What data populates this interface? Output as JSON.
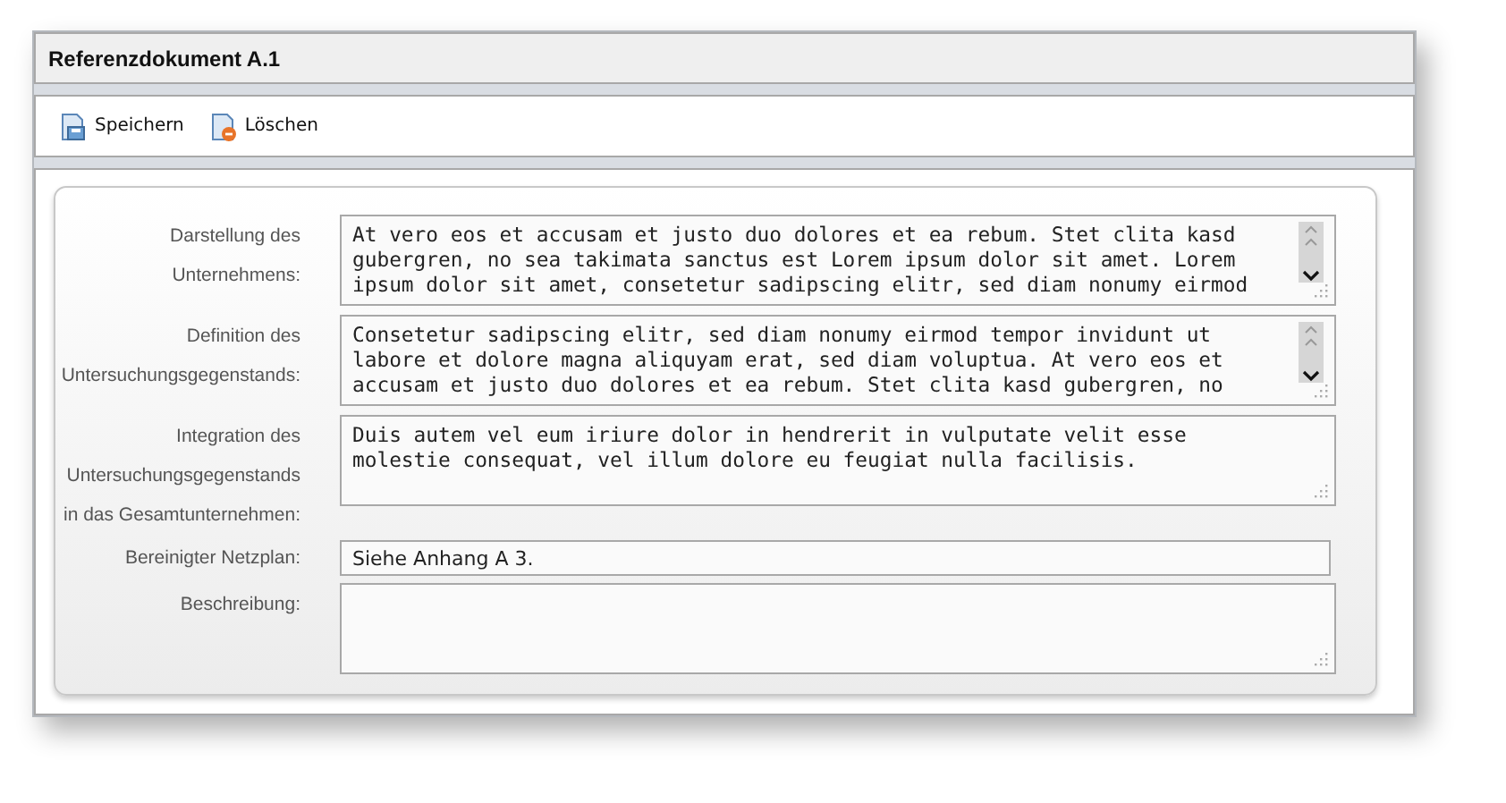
{
  "window": {
    "title": "Referenzdokument A.1"
  },
  "toolbar": [
    {
      "kind": "save",
      "label": "Speichern"
    },
    {
      "kind": "delete",
      "label": "Löschen"
    }
  ],
  "fields": [
    {
      "kind": "textarea",
      "label_lines": [
        "Darstellung des",
        "Unternehmens:"
      ],
      "value": "At vero eos et accusam et justo duo dolores et ea rebum. Stet clita kasd\ngubergren, no sea takimata sanctus est Lorem ipsum dolor sit amet. Lorem\nipsum dolor sit amet, consetetur sadipscing elitr, sed diam nonumy eirmod",
      "scrollbar": true
    },
    {
      "kind": "textarea",
      "label_lines": [
        "Definition des",
        "Untersuchungsgegenstands:"
      ],
      "value": "Consetetur sadipscing elitr, sed diam nonumy eirmod tempor invidunt ut\nlabore et dolore magna aliquyam erat, sed diam voluptua. At vero eos et\naccusam et justo duo dolores et ea rebum. Stet clita kasd gubergren, no",
      "scrollbar": true
    },
    {
      "kind": "textarea",
      "label_lines": [
        "Integration des",
        "Untersuchungsgegenstands",
        "in das Gesamtunternehmen:"
      ],
      "value": "Duis autem vel eum iriure dolor in hendrerit in vulputate velit esse\nmolestie consequat, vel illum dolore eu feugiat nulla facilisis.",
      "scrollbar": false
    },
    {
      "kind": "input",
      "label_lines": [
        "Bereinigter Netzplan:"
      ],
      "value": "Siehe Anhang A 3."
    },
    {
      "kind": "textarea",
      "label_lines": [
        "Beschreibung:"
      ],
      "scrollbar": false
    }
  ]
}
